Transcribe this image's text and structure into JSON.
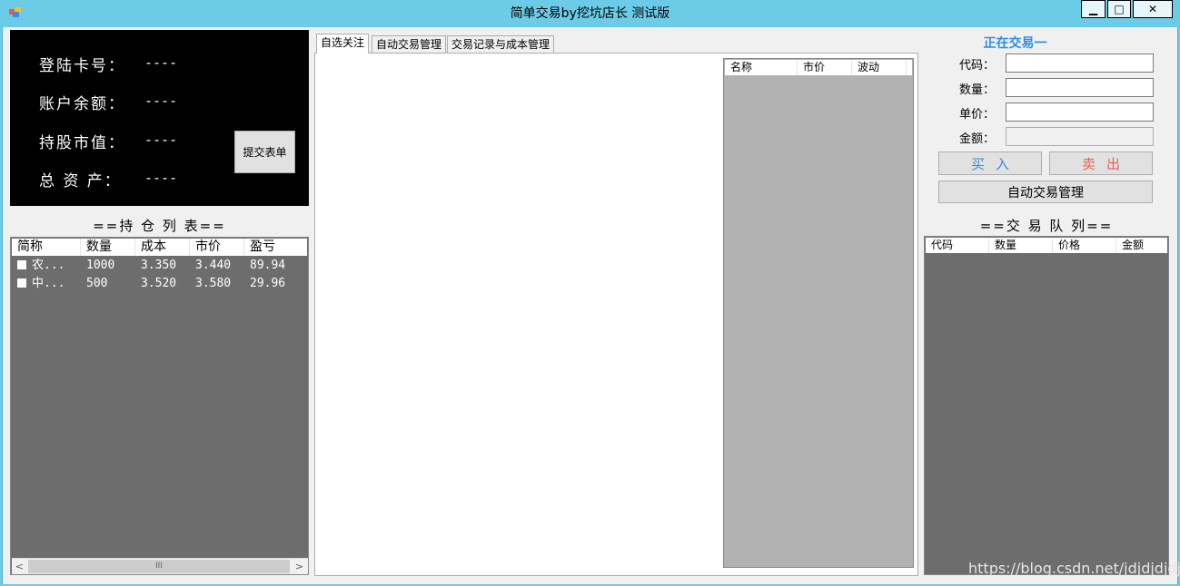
{
  "window": {
    "title": "简单交易by挖坑店长 测试版",
    "controls": {
      "minimize": "▁",
      "maximize": "□",
      "close": "✕"
    }
  },
  "account": {
    "card_label": "登陆卡号：",
    "card_value": "----",
    "balance_label": "账户余额：",
    "balance_value": "----",
    "market_value_label": "持股市值：",
    "market_value_value": "----",
    "total_assets_label": "总 资 产：",
    "total_assets_value": "----",
    "submit_label": "提交表单"
  },
  "holdings": {
    "title": "==持 仓 列 表==",
    "columns": [
      "简称",
      "数量",
      "成本",
      "市价",
      "盈亏"
    ],
    "rows": [
      [
        "农...",
        "1000",
        "3.350",
        "3.440",
        "89.94"
      ],
      [
        "中...",
        "500",
        "3.520",
        "3.580",
        "29.96"
      ]
    ],
    "scroll_left": "<",
    "scroll_right": ">",
    "scroll_thumb": "III"
  },
  "tabs": [
    "自选关注",
    "自动交易管理",
    "交易记录与成本管理"
  ],
  "watchlist": {
    "columns": [
      "名称",
      "市价",
      "波动"
    ]
  },
  "trading": {
    "title": "正在交易一",
    "code_label": "代码：",
    "quantity_label": "数量：",
    "price_label": "单价：",
    "amount_label": "金额：",
    "code_value": "",
    "quantity_value": "",
    "price_value": "",
    "amount_value": "",
    "buy_label": "买入",
    "sell_label": "卖出",
    "auto_label": "自动交易管理"
  },
  "queue": {
    "title": "==交 易 队 列==",
    "columns": [
      "代码",
      "数量",
      "价格",
      "金额"
    ]
  },
  "watermark": "https://blog.csdn.net/jdjdjdjdjdjc",
  "colors": {
    "window_frame": "#6ccbe6",
    "buy": "#2a8de6",
    "sell": "#e8624d",
    "list_background": "#6d6d6d",
    "watch_background": "#b2b2b2"
  }
}
